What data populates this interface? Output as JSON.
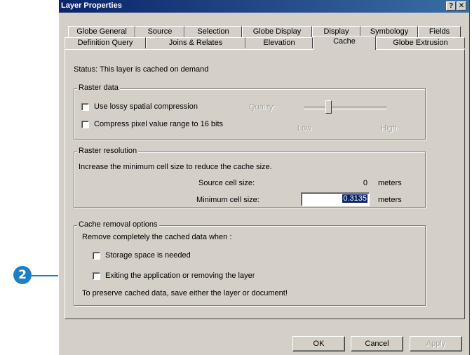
{
  "window": {
    "title": "Layer Properties",
    "help_label": "?",
    "close_label": "✕"
  },
  "tabs_row1": [
    "Globe General",
    "Source",
    "Selection",
    "Globe Display",
    "Display",
    "Symbology",
    "Fields"
  ],
  "tabs_row2": [
    "Definition Query",
    "Joins & Relates",
    "Elevation",
    "Cache",
    "Globe Extrusion"
  ],
  "selected_tab": "Cache",
  "status": "Status:  This layer is cached on demand",
  "raster_data": {
    "label": "Raster data",
    "lossy_label": "Use lossy spatial compression",
    "lossy_checked": false,
    "compress_label": "Compress pixel value range to 16 bits",
    "compress_checked": false,
    "quality_label": "Quality:",
    "quality_low": "Low",
    "quality_high": "High",
    "quality_level": 0.3
  },
  "raster_resolution": {
    "label": "Raster resolution",
    "description": "Increase the minimum cell size to reduce the cache size.",
    "source_label": "Source cell size:",
    "source_value": "0",
    "source_unit": "meters",
    "min_label": "Minimum cell size:",
    "min_value": "0.3135",
    "min_unit": "meters"
  },
  "cache_removal": {
    "label": "Cache removal options",
    "description": "Remove completely the cached data when :",
    "storage_label": "Storage space is needed",
    "storage_checked": false,
    "exit_label": "Exiting the application or removing the layer",
    "exit_checked": false,
    "note": "To preserve cached data, save either the layer or document!"
  },
  "buttons": {
    "ok": "OK",
    "cancel": "Cancel",
    "apply": "Apply"
  },
  "callout": {
    "number": "2",
    "color": "#1f7fc0"
  }
}
